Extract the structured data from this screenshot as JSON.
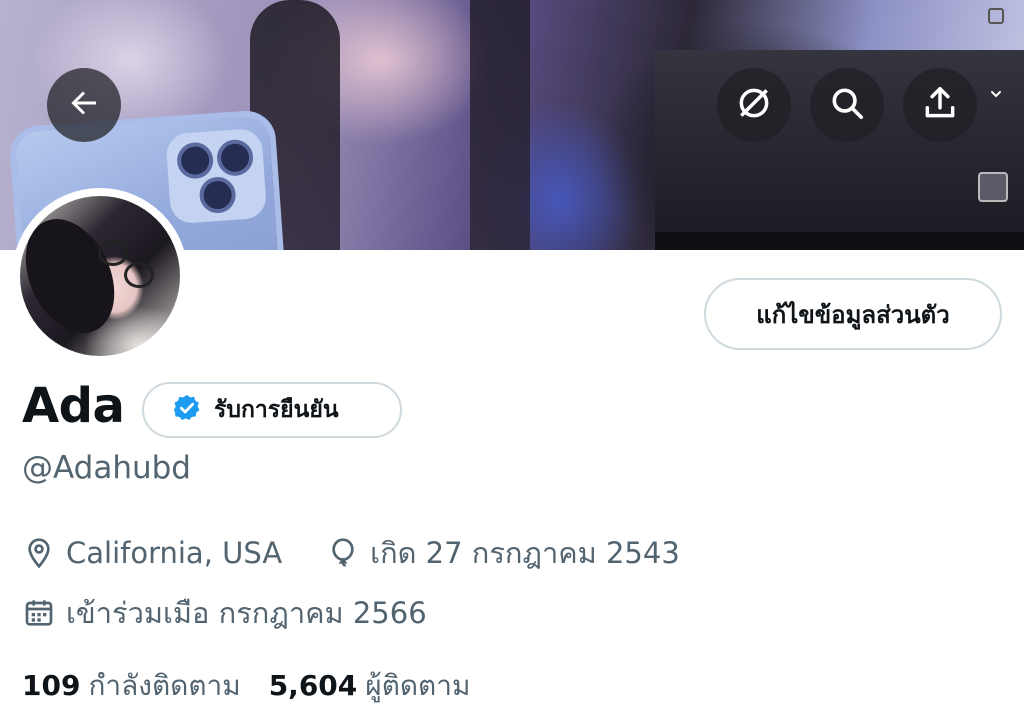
{
  "header": {
    "back_icon": "arrow-left-icon",
    "overlay_buttons": [
      {
        "name": "grok-icon"
      },
      {
        "name": "search-icon"
      },
      {
        "name": "share-icon"
      },
      {
        "name": "chevron-down-icon"
      }
    ]
  },
  "profile": {
    "edit_button_label": "แก้ไขข้อมูลส่วนตัว",
    "display_name": "Ada",
    "verify_label": "รับการยืนยัน",
    "handle": "@Adahubd",
    "location": "California, USA",
    "birthday": "เกิด 27 กรกฎาคม 2543",
    "joined": "เข้าร่วมเมือ กรกฎาคม 2566"
  },
  "stats": {
    "following_count": "109",
    "following_label": "กำลังติดตาม",
    "followers_count": "5,604",
    "followers_label": "ผู้ติดตาม"
  },
  "colors": {
    "accent_blue": "#1d9bf0",
    "secondary_text": "#536471",
    "primary_text": "#0f1419",
    "border": "#cfd9de"
  }
}
